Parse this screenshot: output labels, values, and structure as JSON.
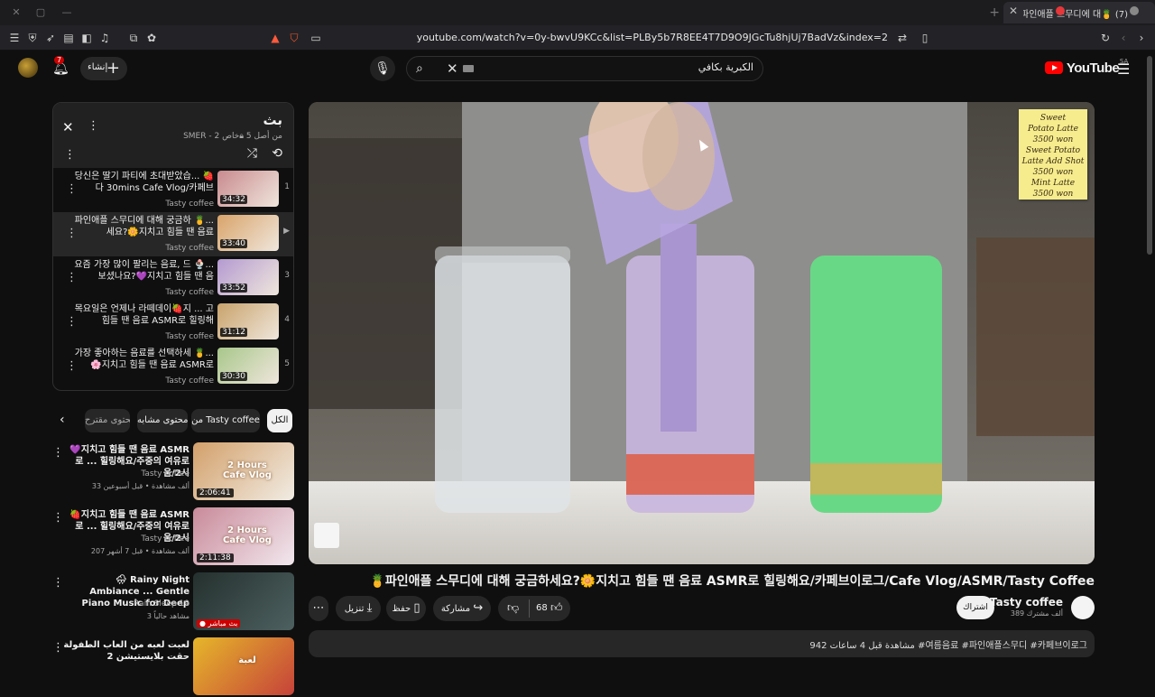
{
  "browser": {
    "tab_title": "(7) 🍍파인애플 스무디에 대",
    "url": "youtube.com/watch?v=0y-bwvU9KCc&list=PLBy5b7R8EE4T7D9O9JGcTu8hjUj7BadVz&index=2"
  },
  "header": {
    "notification_count": "7",
    "create_label": "إنشاء",
    "search_value": "الكبرية بكافي",
    "logo_text": "YouTube",
    "country_code": "SA"
  },
  "playlist": {
    "title": "بث",
    "meta": "SMER - 2 من أصل 5",
    "private_label": "خاص",
    "items": [
      {
        "title": "당신은 딸기 파티에 초대받았습... 🍓다 30mins Cafe Vlog/카페브",
        "channel": "Tasty coffee",
        "duration": "34:32",
        "index": "1"
      },
      {
        "title": "파인애플 스무디에 대해 궁금하 🍍... 세요?🌼지치고 힘들 땐 음료",
        "channel": "Tasty coffee",
        "duration": "33:40",
        "index": "▶"
      },
      {
        "title": "요즘 가장 많이 팔리는 음료, 드 🍨... 보셨나요?💜지치고 힘들 땐 음",
        "channel": "Tasty coffee",
        "duration": "33:52",
        "index": "3"
      },
      {
        "title": "목요일은 언제나 라떼데이🍓지 ... 고 힘들 땐 음료 ASMR로 힐링해",
        "channel": "Tasty coffee",
        "duration": "31:12",
        "index": "4"
      },
      {
        "title": "가장 좋아하는 음료를 선택하세 🍍... 🌸지치고 힘들 땐 음료 ASMR로",
        "channel": "Tasty coffee",
        "duration": "30:30",
        "index": "5"
      }
    ]
  },
  "chips": [
    "الكل",
    "من Tasty coffee",
    "محتوى مشابه",
    "محتوى مقترح"
  ],
  "recommendations": [
    {
      "title": "💜지치고 힘들 땐 음료 ASMR로 ... 힐링해요/주중의 여유로움/2시",
      "channel": "Tasty coffee",
      "meta": "33 ألف مشاهدة • قبل أسبوعين",
      "duration": "2:06:41",
      "thumb_label": "2 Hours Cafe Vlog"
    },
    {
      "title": "🍓지치고 힘들 땐 음료 ASMR로 ... 힐링해요/주중의 여유로움/2시",
      "channel": "Tasty coffee",
      "meta": "207 ألف مشاهدة • قبل 7 أشهر",
      "duration": "2:11:38",
      "thumb_label": "2 Hours Cafe Vlog"
    },
    {
      "title": "🌧 Rainy Night Ambiance ... Gentle Piano Music for Deep",
      "channel": "Rain Sleep 19",
      "meta": "3 مشاهد حالياً",
      "duration": "● بث مباشر",
      "thumb_label": ""
    },
    {
      "title": "لعبت لعبه من العاب الطفولة حقت بلايستيشن 2",
      "channel": "",
      "meta": "",
      "duration": "",
      "thumb_label": "لعبة"
    }
  ],
  "video": {
    "sticky_note": [
      "Sweet",
      "Potato Latte",
      "3500 won",
      "Sweet Potato",
      "Latte Add Shot",
      "3500 won",
      "Mint Latte",
      "3500 won"
    ],
    "title": "🍍파인애플 스무디에 대해 궁금하세요?🌼지치고 힘들 땐 음료 ASMR로 힐링해요/카페브이로그/Cafe Vlog/ASMR/Tasty Coffee",
    "like_count": "68",
    "share_label": "مشاركة",
    "save_label": "حفظ",
    "download_label": "تنزيل",
    "subscribe_label": "اشتراك",
    "channel_name": "Tasty coffee",
    "subscribers": "389 ألف مشترك",
    "description": "942 مشاهدة قبل 4 ساعات #여름음료 #파인애플스무디 #카페브이로그"
  }
}
